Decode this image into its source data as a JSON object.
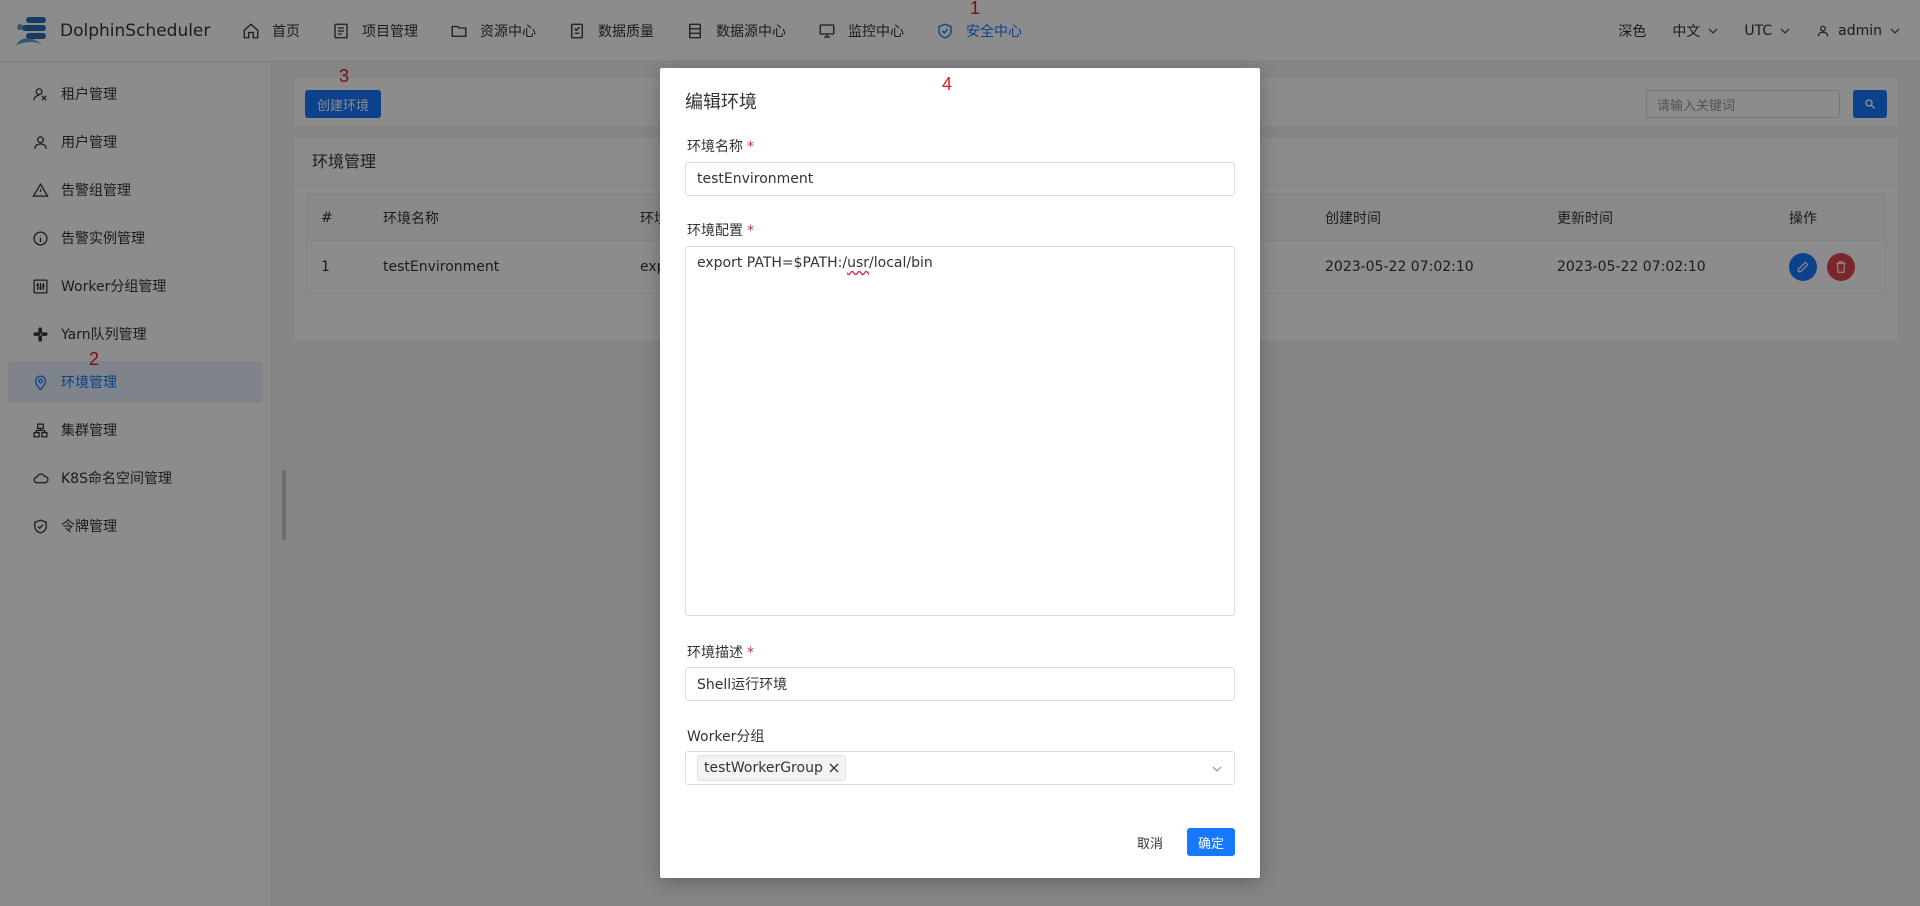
{
  "app": {
    "name": "DolphinScheduler"
  },
  "nav": [
    {
      "label": "首页",
      "icon": "home-icon"
    },
    {
      "label": "项目管理",
      "icon": "project-icon"
    },
    {
      "label": "资源中心",
      "icon": "folder-icon"
    },
    {
      "label": "数据质量",
      "icon": "data-quality-icon"
    },
    {
      "label": "数据源中心",
      "icon": "datasource-icon"
    },
    {
      "label": "监控中心",
      "icon": "monitor-icon"
    },
    {
      "label": "安全中心",
      "icon": "shield-icon",
      "active": true
    }
  ],
  "header_right": {
    "theme": "深色",
    "language": "中文",
    "timezone": "UTC",
    "user": "admin"
  },
  "sidebar": [
    {
      "label": "租户管理",
      "icon": "tenant-icon"
    },
    {
      "label": "用户管理",
      "icon": "user-icon"
    },
    {
      "label": "告警组管理",
      "icon": "warning-icon"
    },
    {
      "label": "告警实例管理",
      "icon": "info-icon"
    },
    {
      "label": "Worker分组管理",
      "icon": "worker-icon"
    },
    {
      "label": "Yarn队列管理",
      "icon": "queue-icon"
    },
    {
      "label": "环境管理",
      "icon": "location-icon",
      "active": true
    },
    {
      "label": "集群管理",
      "icon": "cluster-icon"
    },
    {
      "label": "K8S命名空间管理",
      "icon": "cloud-icon"
    },
    {
      "label": "令牌管理",
      "icon": "token-icon"
    }
  ],
  "toolbar": {
    "create_label": "创建环境",
    "search_placeholder": "请输入关键词"
  },
  "panel": {
    "title": "环境管理"
  },
  "table": {
    "headers": {
      "index": "#",
      "name": "环境名称",
      "config": "环境",
      "created": "创建时间",
      "updated": "更新时间",
      "actions": "操作"
    },
    "rows": [
      {
        "index": "1",
        "name": "testEnvironment",
        "config": "exp",
        "created": "2023-05-22 07:02:10",
        "updated": "2023-05-22 07:02:10"
      }
    ]
  },
  "modal": {
    "title": "编辑环境",
    "name_label": "环境名称",
    "name_value": "testEnvironment",
    "config_label": "环境配置",
    "config_prefix": "export PATH=$PATH:/",
    "config_spell": "usr",
    "config_suffix": "/local/bin",
    "desc_label": "环境描述",
    "desc_value": "Shell运行环境",
    "worker_label": "Worker分组",
    "worker_tag": "testWorkerGroup",
    "cancel": "取消",
    "confirm": "确定"
  },
  "annotations": {
    "a1": "1",
    "a2": "2",
    "a3": "3",
    "a4": "4"
  },
  "colors": {
    "accent": "#1677ff",
    "danger": "#e0464e",
    "annotation": "#e01818"
  }
}
